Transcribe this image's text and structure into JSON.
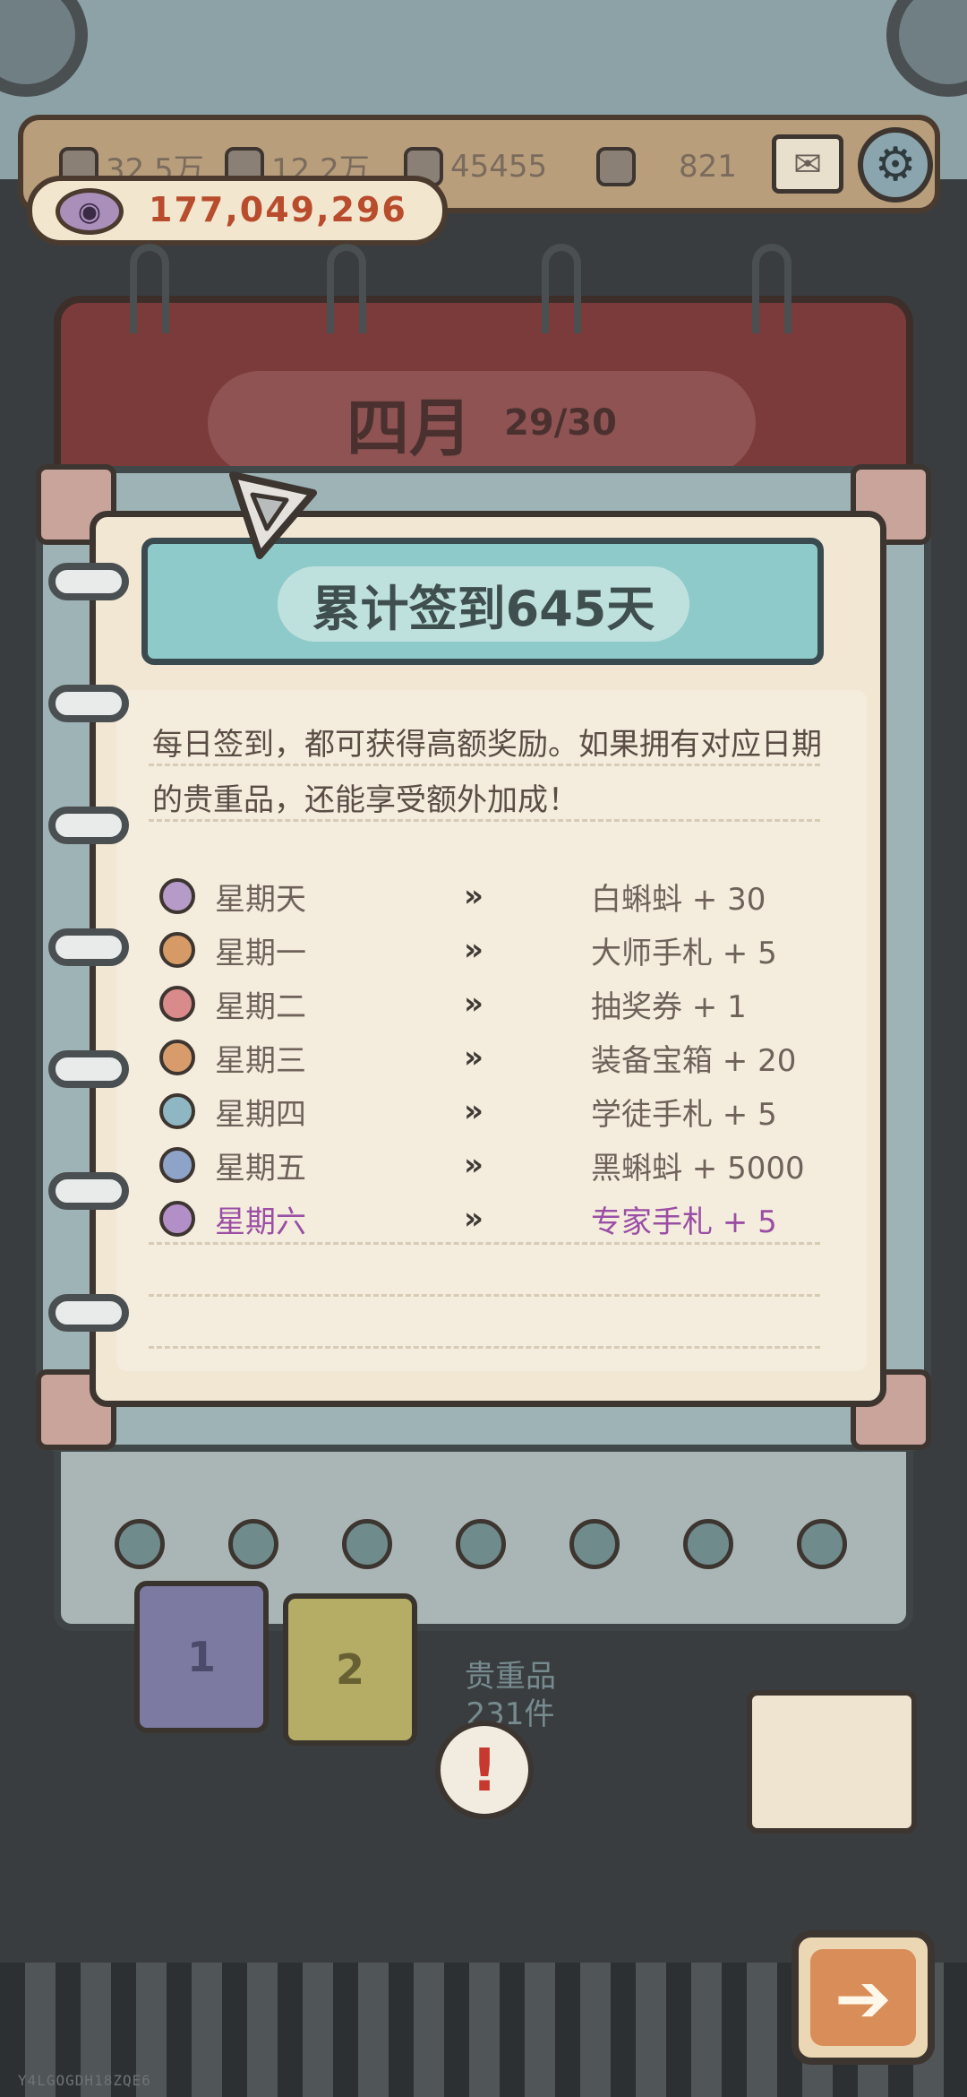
{
  "top_bar": {
    "resources": [
      {
        "icon": "bottle-icon",
        "value": "32.5万"
      },
      {
        "icon": "bottle-icon",
        "value": "12.2万"
      },
      {
        "icon": "lamp-icon",
        "value": "45455"
      },
      {
        "icon": "crate-icon",
        "value": "821"
      }
    ],
    "coins": "177,049,296"
  },
  "calendar": {
    "month": "四月",
    "progress": "29/30"
  },
  "dialog": {
    "title": "累计签到645天",
    "intro": "每日签到，都可获得高额奖励。如果拥有对应日期的贵重品，还能享受额外加成！",
    "rows": [
      {
        "day": "星期天",
        "reward": "白蝌蚪 + 30",
        "icon": "tadpole-icon",
        "color": "#b69ac7"
      },
      {
        "day": "星期一",
        "reward": "大师手札 + 5",
        "icon": "wrench-icon",
        "color": "#d69a66"
      },
      {
        "day": "星期二",
        "reward": "抽奖券 + 1",
        "icon": "ticket-icon",
        "color": "#d98a8a"
      },
      {
        "day": "星期三",
        "reward": "装备宝箱 + 20",
        "icon": "chest-icon",
        "color": "#d89c6c"
      },
      {
        "day": "星期四",
        "reward": "学徒手札 + 5",
        "icon": "wrench-icon",
        "color": "#8fb7c3"
      },
      {
        "day": "星期五",
        "reward": "黑蝌蚪 + 5000",
        "icon": "tadpole-icon",
        "color": "#8ea3c8"
      },
      {
        "day": "星期六",
        "reward": "专家手札 + 5",
        "icon": "wrench-icon",
        "color": "#b38fc7",
        "active": true
      }
    ]
  },
  "lower": {
    "tabs": [
      "1",
      "2"
    ],
    "precious_label": "贵重品",
    "precious_count": "231件"
  },
  "footer_code": "Y4LGOGDH18ZQE6"
}
